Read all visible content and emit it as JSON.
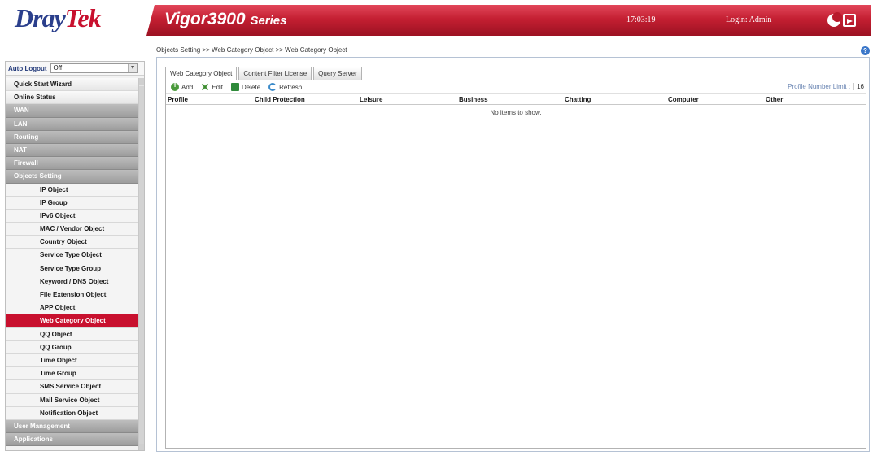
{
  "header": {
    "logo_main": "Dray",
    "logo_accent": "Tek",
    "model_name": "Vigor3900",
    "model_series": "Series",
    "clock": "17:03:19",
    "login": "Login: Admin",
    "accent_color": "#c8102e"
  },
  "breadcrumb": "Objects Setting >> Web Category Object >> Web Category Object",
  "help_label": "?",
  "sidebar": {
    "auto_logout_label": "Auto Logout",
    "auto_logout_value": "Off",
    "items": [
      {
        "label": "Quick Start Wizard",
        "kind": "top"
      },
      {
        "label": "Online Status",
        "kind": "top"
      },
      {
        "label": "WAN",
        "kind": "group"
      },
      {
        "label": "LAN",
        "kind": "group"
      },
      {
        "label": "Routing",
        "kind": "group"
      },
      {
        "label": "NAT",
        "kind": "group"
      },
      {
        "label": "Firewall",
        "kind": "group"
      },
      {
        "label": "Objects Setting",
        "kind": "group"
      },
      {
        "label": "IP Object",
        "kind": "sub"
      },
      {
        "label": "IP Group",
        "kind": "sub"
      },
      {
        "label": "IPv6 Object",
        "kind": "sub"
      },
      {
        "label": "MAC / Vendor Object",
        "kind": "sub"
      },
      {
        "label": "Country Object",
        "kind": "sub"
      },
      {
        "label": "Service Type Object",
        "kind": "sub"
      },
      {
        "label": "Service Type Group",
        "kind": "sub"
      },
      {
        "label": "Keyword / DNS Object",
        "kind": "sub"
      },
      {
        "label": "File Extension Object",
        "kind": "sub"
      },
      {
        "label": "APP Object",
        "kind": "sub"
      },
      {
        "label": "Web Category Object",
        "kind": "sub",
        "active": true
      },
      {
        "label": "QQ Object",
        "kind": "sub"
      },
      {
        "label": "QQ Group",
        "kind": "sub"
      },
      {
        "label": "Time Object",
        "kind": "sub"
      },
      {
        "label": "Time Group",
        "kind": "sub"
      },
      {
        "label": "SMS Service Object",
        "kind": "sub"
      },
      {
        "label": "Mail Service Object",
        "kind": "sub"
      },
      {
        "label": "Notification Object",
        "kind": "sub"
      },
      {
        "label": "User Management",
        "kind": "group"
      },
      {
        "label": "Applications",
        "kind": "group"
      }
    ]
  },
  "tabs": [
    {
      "label": "Web Category Object",
      "active": true
    },
    {
      "label": "Content Filter License",
      "active": false
    },
    {
      "label": "Query Server",
      "active": false
    }
  ],
  "toolbar": {
    "add": "Add",
    "edit": "Edit",
    "delete": "Delete",
    "refresh": "Refresh",
    "limit_label": "Profile Number Limit :",
    "limit_value": "16"
  },
  "table": {
    "columns": [
      "Profile",
      "Child Protection",
      "Leisure",
      "Business",
      "Chatting",
      "Computer",
      "Other"
    ],
    "empty_text": "No items to show."
  }
}
